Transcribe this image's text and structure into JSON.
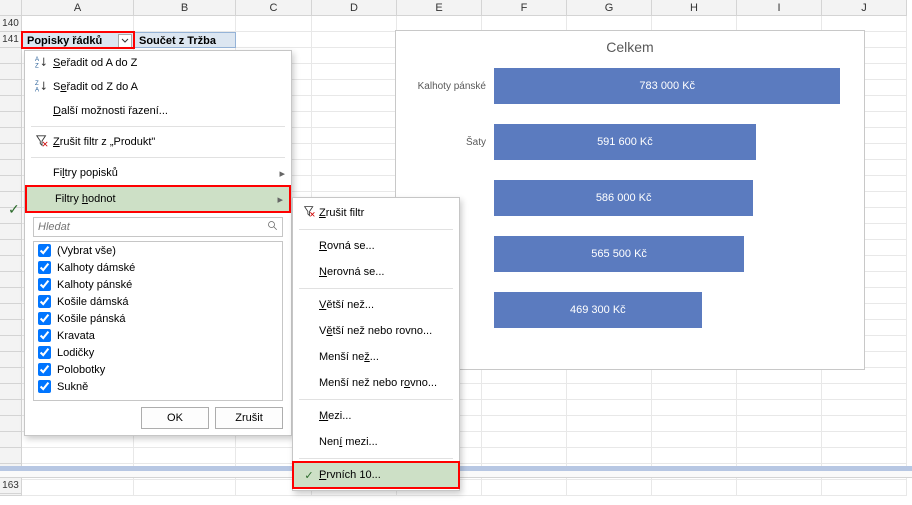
{
  "columns": [
    "A",
    "B",
    "C",
    "D",
    "E",
    "F",
    "G",
    "H",
    "I",
    "J"
  ],
  "rows": {
    "r1": "140",
    "r2": "141",
    "rBottom": "163"
  },
  "pivot": {
    "row_label": "Popisky řádků",
    "value_label": "Součet z Tržba"
  },
  "menu": {
    "sort_az": "Seřadit od A do Z",
    "sort_za": "Seřadit od Z do A",
    "more_sort": "Další možnosti řazení...",
    "clear_filter": "Zrušit filtr z „Produkt\"",
    "label_filters": "Filtry popisků",
    "value_filters": "Filtry hodnot",
    "search_placeholder": "Hledat",
    "items": [
      "(Vybrat vše)",
      "Kalhoty dámské",
      "Kalhoty pánské",
      "Košile dámská",
      "Košile pánská",
      "Kravata",
      "Lodičky",
      "Polobotky",
      "Sukně"
    ],
    "ok": "OK",
    "cancel": "Zrušit"
  },
  "submenu": {
    "clear": "Zrušit filtr",
    "equals": "Rovná se...",
    "not_equals": "Nerovná se...",
    "gt": "Větší než...",
    "gte": "Větší než nebo rovno...",
    "lt": "Menší než...",
    "lte": "Menší než nebo rovno...",
    "between": "Mezi...",
    "not_between": "Není mezi...",
    "top10": "Prvních 10..."
  },
  "chart": {
    "title": "Celkem",
    "max": 800000
  },
  "chart_data": {
    "type": "bar",
    "orientation": "horizontal",
    "title": "Celkem",
    "categories": [
      "Kalhoty pánské",
      "Šaty",
      "",
      "",
      ""
    ],
    "series": [
      {
        "name": "Celkem",
        "values": [
          783000,
          591600,
          586000,
          565500,
          469300
        ],
        "labels": [
          "783 000 Kč",
          "591 600 Kč",
          "586 000 Kč",
          "565 500 Kč",
          "469 300 Kč"
        ]
      }
    ],
    "xlabel": "",
    "ylabel": "",
    "xlim": [
      0,
      800000
    ]
  }
}
